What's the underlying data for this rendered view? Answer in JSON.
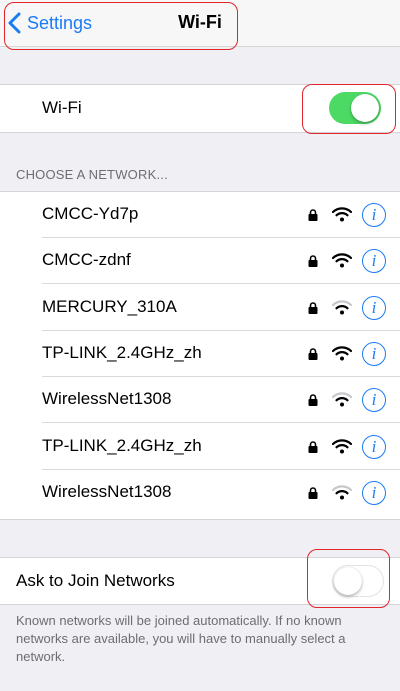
{
  "nav": {
    "back_label": "Settings",
    "title": "Wi-Fi"
  },
  "wifi_row": {
    "label": "Wi-Fi",
    "enabled": true
  },
  "networks_section": {
    "header": "CHOOSE A NETWORK...",
    "networks": [
      {
        "name": "CMCC-Yd7p",
        "locked": true,
        "signal_bars": 3
      },
      {
        "name": "CMCC-zdnf",
        "locked": true,
        "signal_bars": 3
      },
      {
        "name": "MERCURY_310A",
        "locked": true,
        "signal_bars": 2
      },
      {
        "name": "TP-LINK_2.4GHz_zh",
        "locked": true,
        "signal_bars": 3
      },
      {
        "name": "WirelessNet1308",
        "locked": true,
        "signal_bars": 2
      },
      {
        "name": "TP-LINK_2.4GHz_zh",
        "locked": true,
        "signal_bars": 3
      },
      {
        "name": "WirelessNet1308",
        "locked": true,
        "signal_bars": 2
      }
    ],
    "info_glyph": "i"
  },
  "ask_to_join": {
    "label": "Ask to Join Networks",
    "enabled": false,
    "footer": "Known networks will be joined automatically. If no known networks are available, you will have to manually select a network."
  },
  "colors": {
    "accent": "#1a7cf5",
    "toggle_on": "#4cd964",
    "annotation": "#e0262b",
    "background": "#efeff4"
  }
}
